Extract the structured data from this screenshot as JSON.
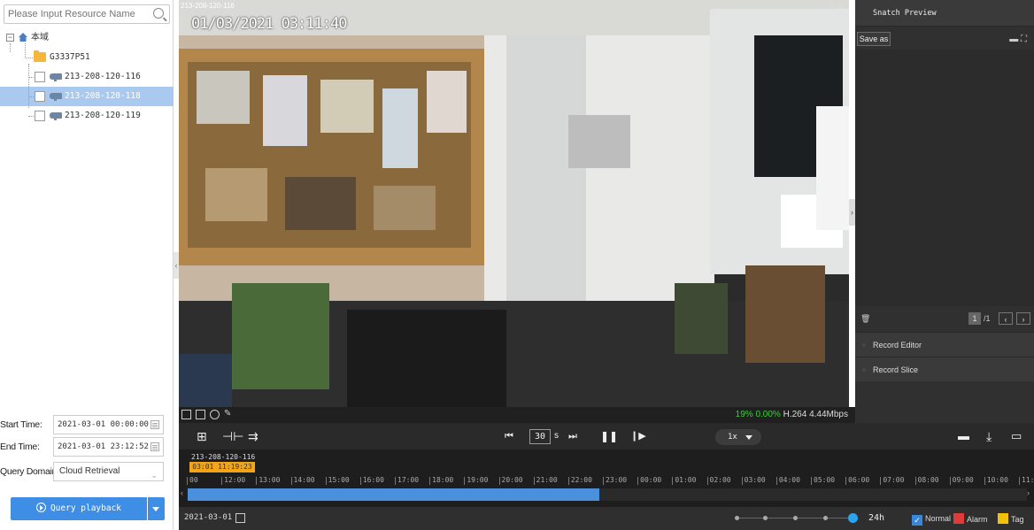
{
  "left_panel": {
    "search_placeholder": "Please Input Resource Name",
    "tree": {
      "root_label": "本域",
      "folder_label": "G3337P51",
      "cameras": [
        "213-208-120-116",
        "213-208-120-118",
        "213-208-120-119"
      ],
      "selected_index": 1
    },
    "start_time_label": "Start Time:",
    "start_time_value": "2021-03-01 00:00:00",
    "end_time_label": "End Time:",
    "end_time_value": "2021-03-01 23:12:52",
    "query_domain_label": "Query Domain:",
    "query_domain_value": "Cloud Retrieval",
    "query_button_label": "Query playback"
  },
  "video": {
    "window_title": "213-208-120-116",
    "osd_timestamp": "01/03/2021 03:11:40",
    "stat_percent": "19%",
    "stat_loss": "0.00%",
    "stat_codec": "H.264",
    "stat_bitrate": "4.44Mbps"
  },
  "right_panel": {
    "title": "Snatch Preview",
    "save_as_label": "Save as",
    "page_current": "1",
    "page_total": "/1",
    "record_editor_label": "Record Editor",
    "record_slice_label": "Record Slice"
  },
  "playback_toolbar": {
    "step_value": "30",
    "step_unit": "s",
    "speed": "1x"
  },
  "timeline": {
    "camera_label": "213-208-120-116",
    "current_time": "03:01 11:19:23",
    "ticks": [
      "00",
      "12:00",
      "13:00",
      "14:00",
      "15:00",
      "16:00",
      "17:00",
      "18:00",
      "19:00",
      "20:00",
      "21:00",
      "22:00",
      "23:00",
      "00:00",
      "01:00",
      "02:00",
      "03:00",
      "04:00",
      "05:00",
      "06:00",
      "07:00",
      "08:00",
      "09:00",
      "10:00",
      "11:"
    ],
    "recorded_fraction": 0.49
  },
  "bottom_bar": {
    "date": "2021-03-01",
    "zoom_label": "24h",
    "legend": [
      {
        "label": "Normal",
        "color": "#3a86d8",
        "checked": true
      },
      {
        "label": "Alarm",
        "color": "#e03b3b",
        "checked": false
      },
      {
        "label": "Tag",
        "color": "#f0c20c",
        "checked": false
      }
    ]
  }
}
